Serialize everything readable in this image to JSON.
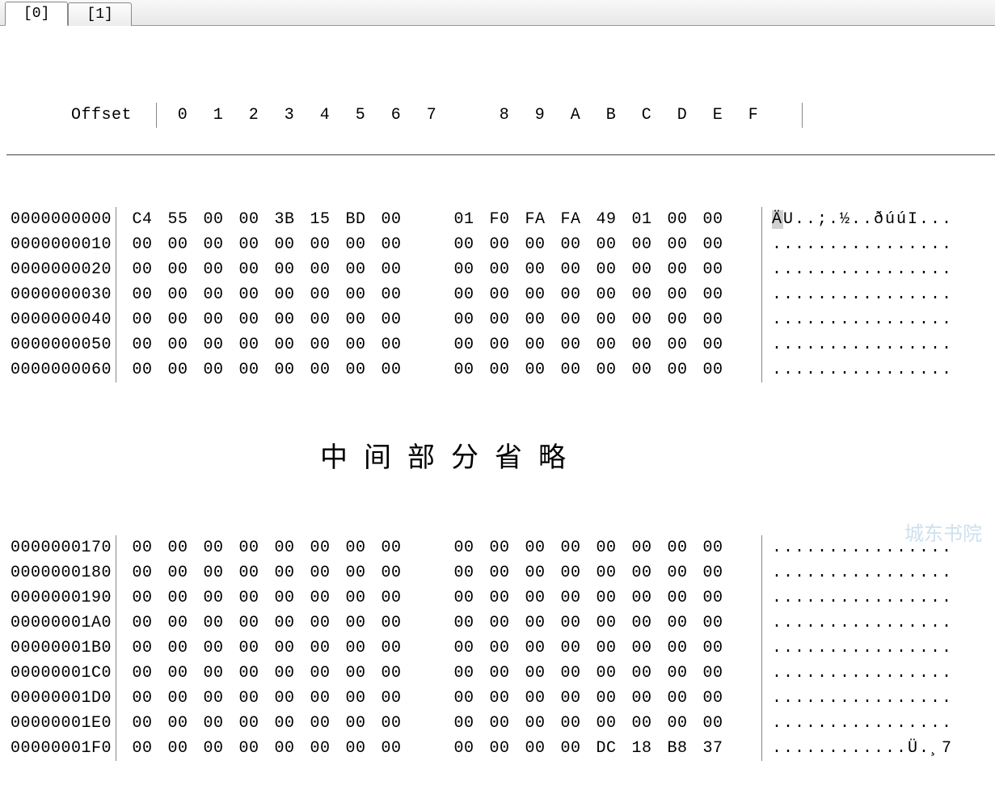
{
  "tabs": [
    {
      "label": "[0]",
      "active": true
    },
    {
      "label": "[1]",
      "active": false
    }
  ],
  "header": {
    "offset_label": "Offset",
    "cols": [
      "0",
      "1",
      "2",
      "3",
      "4",
      "5",
      "6",
      "7",
      "8",
      "9",
      "A",
      "B",
      "C",
      "D",
      "E",
      "F"
    ]
  },
  "rows_top": [
    {
      "offset": "0000000000",
      "hex": [
        "C4",
        "55",
        "00",
        "00",
        "3B",
        "15",
        "BD",
        "00",
        "01",
        "F0",
        "FA",
        "FA",
        "49",
        "01",
        "00",
        "00"
      ],
      "ascii": "ÄU..;.½..ðúúI..."
    },
    {
      "offset": "0000000010",
      "hex": [
        "00",
        "00",
        "00",
        "00",
        "00",
        "00",
        "00",
        "00",
        "00",
        "00",
        "00",
        "00",
        "00",
        "00",
        "00",
        "00"
      ],
      "ascii": "................"
    },
    {
      "offset": "0000000020",
      "hex": [
        "00",
        "00",
        "00",
        "00",
        "00",
        "00",
        "00",
        "00",
        "00",
        "00",
        "00",
        "00",
        "00",
        "00",
        "00",
        "00"
      ],
      "ascii": "................"
    },
    {
      "offset": "0000000030",
      "hex": [
        "00",
        "00",
        "00",
        "00",
        "00",
        "00",
        "00",
        "00",
        "00",
        "00",
        "00",
        "00",
        "00",
        "00",
        "00",
        "00"
      ],
      "ascii": "................"
    },
    {
      "offset": "0000000040",
      "hex": [
        "00",
        "00",
        "00",
        "00",
        "00",
        "00",
        "00",
        "00",
        "00",
        "00",
        "00",
        "00",
        "00",
        "00",
        "00",
        "00"
      ],
      "ascii": "................"
    },
    {
      "offset": "0000000050",
      "hex": [
        "00",
        "00",
        "00",
        "00",
        "00",
        "00",
        "00",
        "00",
        "00",
        "00",
        "00",
        "00",
        "00",
        "00",
        "00",
        "00"
      ],
      "ascii": "................"
    },
    {
      "offset": "0000000060",
      "hex": [
        "00",
        "00",
        "00",
        "00",
        "00",
        "00",
        "00",
        "00",
        "00",
        "00",
        "00",
        "00",
        "00",
        "00",
        "00",
        "00"
      ],
      "ascii": "................"
    }
  ],
  "ellipsis_text": "中间部分省略",
  "rows_bottom": [
    {
      "offset": "0000000170",
      "hex": [
        "00",
        "00",
        "00",
        "00",
        "00",
        "00",
        "00",
        "00",
        "00",
        "00",
        "00",
        "00",
        "00",
        "00",
        "00",
        "00"
      ],
      "ascii": "................"
    },
    {
      "offset": "0000000180",
      "hex": [
        "00",
        "00",
        "00",
        "00",
        "00",
        "00",
        "00",
        "00",
        "00",
        "00",
        "00",
        "00",
        "00",
        "00",
        "00",
        "00"
      ],
      "ascii": "................"
    },
    {
      "offset": "0000000190",
      "hex": [
        "00",
        "00",
        "00",
        "00",
        "00",
        "00",
        "00",
        "00",
        "00",
        "00",
        "00",
        "00",
        "00",
        "00",
        "00",
        "00"
      ],
      "ascii": "................"
    },
    {
      "offset": "00000001A0",
      "hex": [
        "00",
        "00",
        "00",
        "00",
        "00",
        "00",
        "00",
        "00",
        "00",
        "00",
        "00",
        "00",
        "00",
        "00",
        "00",
        "00"
      ],
      "ascii": "................"
    },
    {
      "offset": "00000001B0",
      "hex": [
        "00",
        "00",
        "00",
        "00",
        "00",
        "00",
        "00",
        "00",
        "00",
        "00",
        "00",
        "00",
        "00",
        "00",
        "00",
        "00"
      ],
      "ascii": "................"
    },
    {
      "offset": "00000001C0",
      "hex": [
        "00",
        "00",
        "00",
        "00",
        "00",
        "00",
        "00",
        "00",
        "00",
        "00",
        "00",
        "00",
        "00",
        "00",
        "00",
        "00"
      ],
      "ascii": "................"
    },
    {
      "offset": "00000001D0",
      "hex": [
        "00",
        "00",
        "00",
        "00",
        "00",
        "00",
        "00",
        "00",
        "00",
        "00",
        "00",
        "00",
        "00",
        "00",
        "00",
        "00"
      ],
      "ascii": "................"
    },
    {
      "offset": "00000001E0",
      "hex": [
        "00",
        "00",
        "00",
        "00",
        "00",
        "00",
        "00",
        "00",
        "00",
        "00",
        "00",
        "00",
        "00",
        "00",
        "00",
        "00"
      ],
      "ascii": "................"
    },
    {
      "offset": "00000001F0",
      "hex": [
        "00",
        "00",
        "00",
        "00",
        "00",
        "00",
        "00",
        "00",
        "00",
        "00",
        "00",
        "00",
        "DC",
        "18",
        "B8",
        "37"
      ],
      "ascii": "............Ü.¸7"
    }
  ],
  "watermark": "城东书院"
}
